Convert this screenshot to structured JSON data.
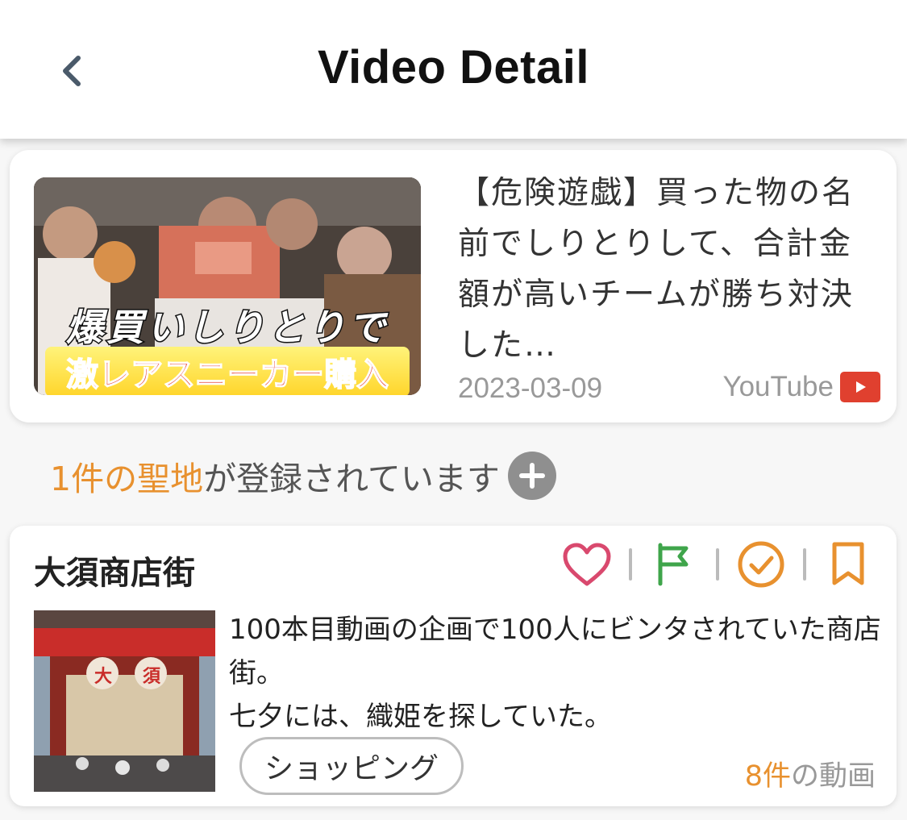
{
  "header": {
    "title": "Video Detail"
  },
  "video": {
    "title": "【危険遊戯】買った物の名前でしりとりして、合計金額が高いチームが勝ち対決した…",
    "date": "2023-03-09",
    "source": "YouTube",
    "thumbnail": {
      "caption1": "爆買いしりとりで",
      "caption2": "激レアスニーカー購入"
    }
  },
  "registered": {
    "count_text": "1件の聖地",
    "suffix": "が登録されています"
  },
  "spot": {
    "name": "大須商店街",
    "description_line1": "100本目動画の企画で100人にビンタされていた商店街。",
    "description_line2": "七夕には、織姫を探していた。",
    "tag": "ショッピング",
    "video_count": "8件",
    "video_count_suffix": "の動画",
    "image_signs": [
      "大",
      "須"
    ]
  },
  "colors": {
    "accent": "#e8912f",
    "heart": "#d9496e",
    "flag": "#3fa54b",
    "check": "#e8912f",
    "bookmark": "#e8912f",
    "youtube": "#e0402f"
  },
  "icons": [
    "back-chevron-icon",
    "youtube-icon",
    "plus-icon",
    "heart-icon",
    "flag-icon",
    "check-circle-icon",
    "bookmark-icon"
  ]
}
